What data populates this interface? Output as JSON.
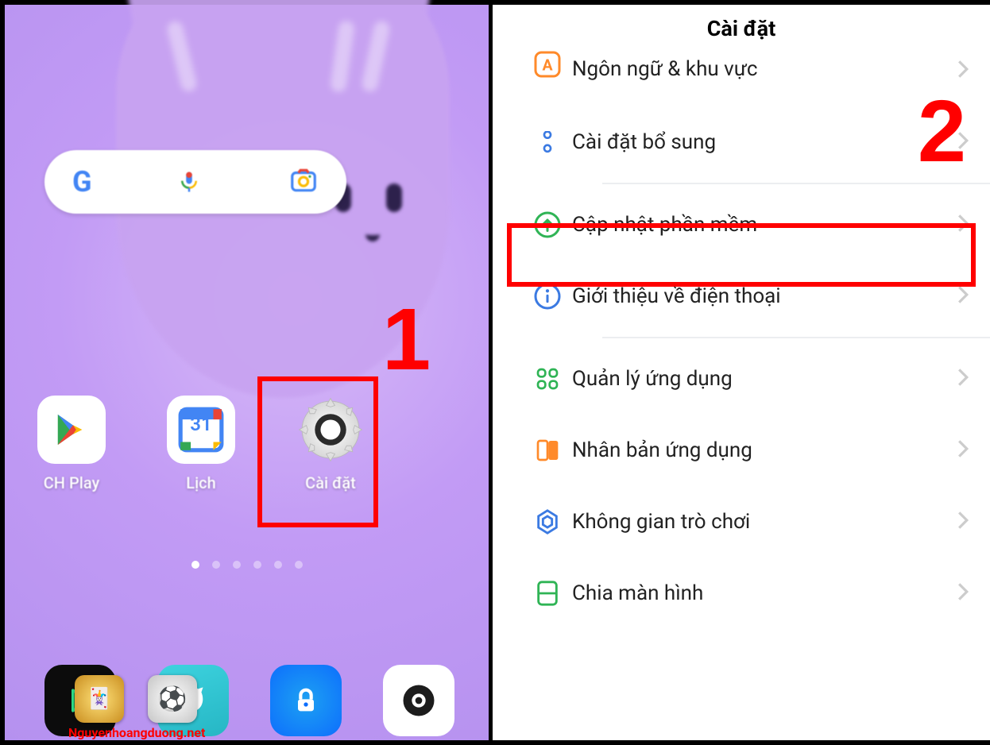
{
  "stepNumbers": {
    "one": "1",
    "two": "2"
  },
  "left": {
    "apps": {
      "chplay": "CH Play",
      "calendar": "Lịch",
      "calendar_day": "31",
      "settings": "Cài đặt"
    }
  },
  "right": {
    "title": "Cài đặt",
    "items": {
      "language": "Ngôn ngữ & khu vực",
      "additional": "Cài đặt bổ sung",
      "update": "Cập nhật phần mềm",
      "about": "Giới thiệu về điện thoại",
      "appmgmt": "Quản lý ứng dụng",
      "appclone": "Nhân bản ứng dụng",
      "gamespace": "Không gian trò chơi",
      "splitscreen": "Chia màn hình"
    }
  },
  "watermark": "Nguyenhoangduong.net"
}
